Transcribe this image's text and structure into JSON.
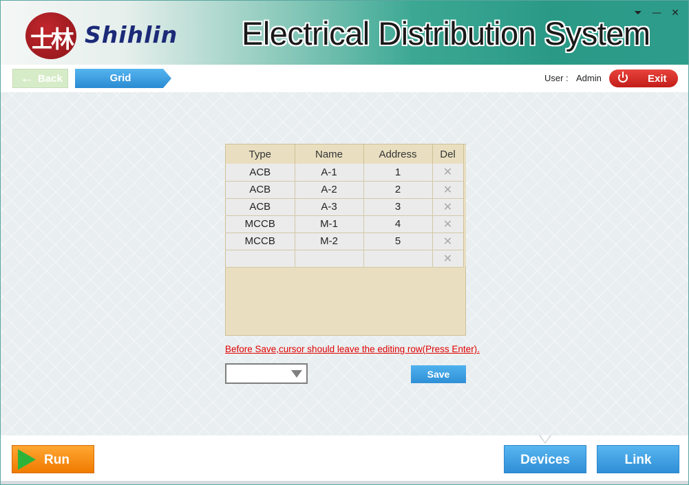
{
  "header": {
    "logo_mark": "士林",
    "brand": "Shihlin",
    "title": "Electrical Distribution System",
    "controls": {
      "menu": "⏷",
      "minimize": "—",
      "close": "✕"
    }
  },
  "toolbar": {
    "back_label": "Back",
    "tab_label": "Grid",
    "user_label": "User :",
    "user_name": "Admin",
    "exit_label": "Exit"
  },
  "grid": {
    "columns": [
      "Type",
      "Name",
      "Address",
      "Del"
    ],
    "rows": [
      {
        "type": "ACB",
        "name": "A-1",
        "address": "1",
        "del": "✕"
      },
      {
        "type": "ACB",
        "name": "A-2",
        "address": "2",
        "del": "✕"
      },
      {
        "type": "ACB",
        "name": "A-3",
        "address": "3",
        "del": "✕"
      },
      {
        "type": "MCCB",
        "name": "M-1",
        "address": "4",
        "del": "✕"
      },
      {
        "type": "MCCB",
        "name": "M-2",
        "address": "5",
        "del": "✕"
      },
      {
        "type": "",
        "name": "",
        "address": "",
        "del": "✕"
      }
    ]
  },
  "hint": "Before Save,cursor should leave the editing row(Press Enter).",
  "select": {
    "value": ""
  },
  "save_label": "Save",
  "footer": {
    "run_label": "Run",
    "devices_label": "Devices",
    "link_label": "Link"
  },
  "colors": {
    "accent_blue": "#2f8fd6",
    "exit_red": "#c21d18",
    "run_orange": "#f07a00",
    "hint_red": "#e00000",
    "grid_header": "#e9dfc0"
  }
}
